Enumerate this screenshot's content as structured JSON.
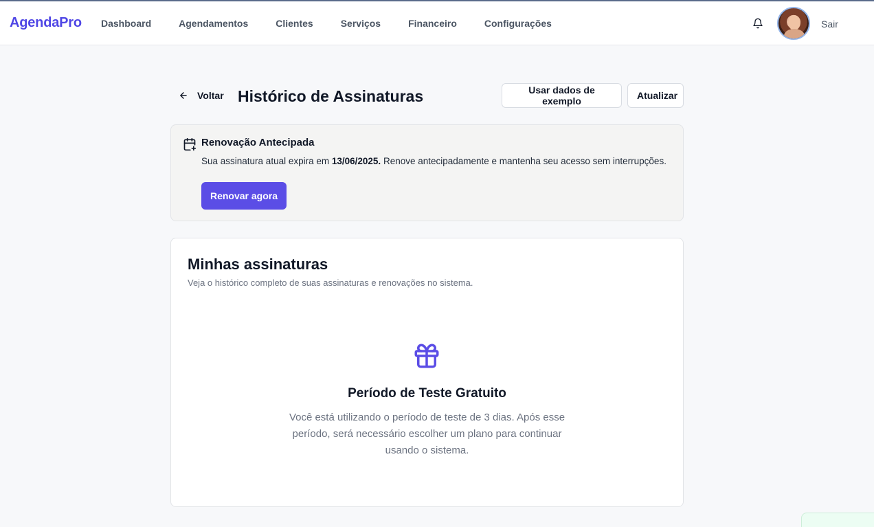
{
  "header": {
    "brand": "AgendaPro",
    "nav": [
      {
        "label": "Dashboard"
      },
      {
        "label": "Agendamentos"
      },
      {
        "label": "Clientes"
      },
      {
        "label": "Serviços"
      },
      {
        "label": "Financeiro"
      },
      {
        "label": "Configurações"
      }
    ],
    "logout_label": "Sair"
  },
  "page": {
    "back_label": "Voltar",
    "title": "Histórico de Assinaturas",
    "example_button": "Usar dados de exemplo",
    "refresh_button": "Atualizar"
  },
  "renewal": {
    "title": "Renovação Antecipada",
    "text_before": "Sua assinatura atual expira em ",
    "expiry_date": "13/06/2025.",
    "text_after": " Renove antecipadamente e mantenha seu acesso sem interrupções.",
    "button": "Renovar agora"
  },
  "subscriptions": {
    "title": "Minhas assinaturas",
    "description": "Veja o histórico completo de suas assinaturas e renovações no sistema.",
    "empty_title": "Período de Teste Gratuito",
    "empty_text": "Você está utilizando o período de teste de 3 dias. Após esse período, será necessário escolher um plano para continuar usando o sistema."
  },
  "colors": {
    "brand": "#4f46e5",
    "primary_button": "#5b4de6",
    "gift_icon": "#5b4de6"
  },
  "icons": {
    "back": "arrow-left-icon",
    "notifications": "bell-icon",
    "renewal": "calendar-plus-icon",
    "empty_state": "gift-icon"
  }
}
